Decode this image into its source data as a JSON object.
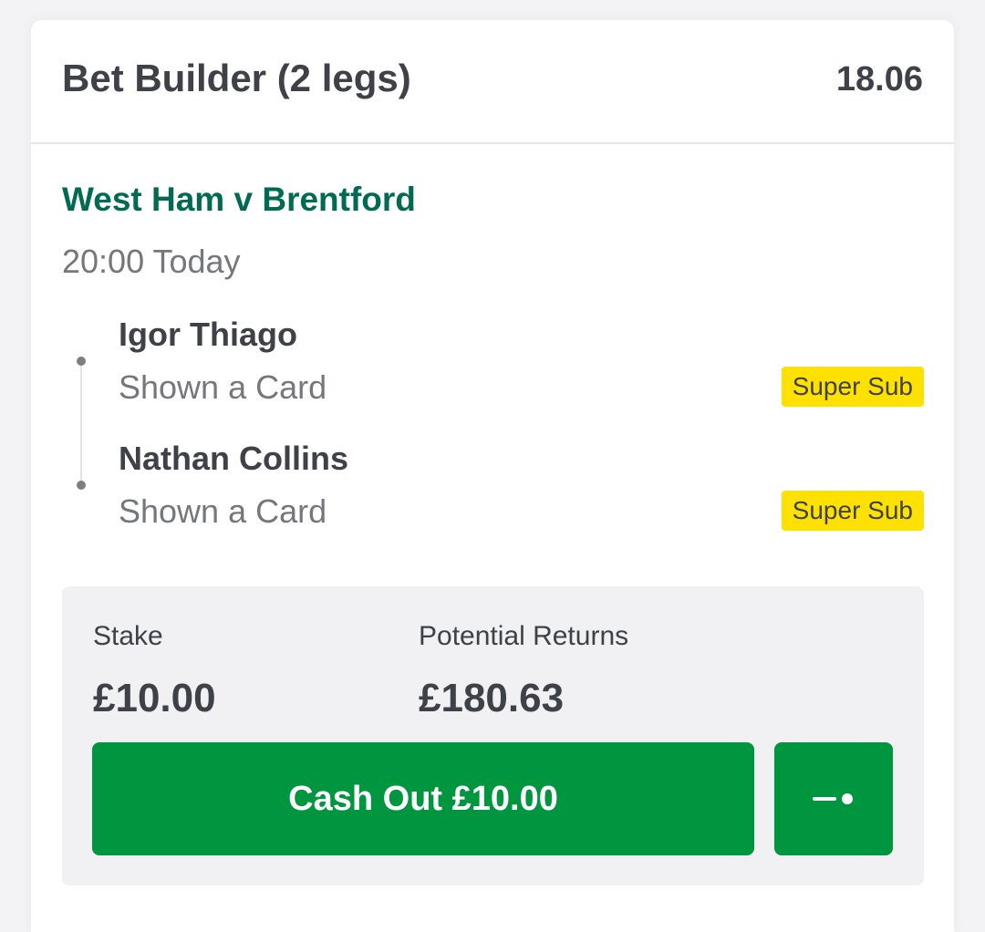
{
  "bet": {
    "title": "Bet Builder (2 legs)",
    "odds": "18.06"
  },
  "match": {
    "title": "West Ham v Brentford",
    "time": "20:00 Today"
  },
  "legs": [
    {
      "player": "Igor Thiago",
      "market": "Shown a Card",
      "badge": "Super Sub"
    },
    {
      "player": "Nathan Collins",
      "market": "Shown a Card",
      "badge": "Super Sub"
    }
  ],
  "stake": {
    "label": "Stake",
    "value": "£10.00"
  },
  "returns": {
    "label": "Potential Returns",
    "value": "£180.63"
  },
  "cashout": {
    "label": "Cash Out £10.00",
    "slider_icon": "slider-toggle-icon"
  },
  "colors": {
    "accent_green": "#00963f",
    "match_green": "#006a52",
    "badge_yellow": "#ffe100",
    "text_dark": "#3f4148",
    "text_muted": "#76777c"
  }
}
